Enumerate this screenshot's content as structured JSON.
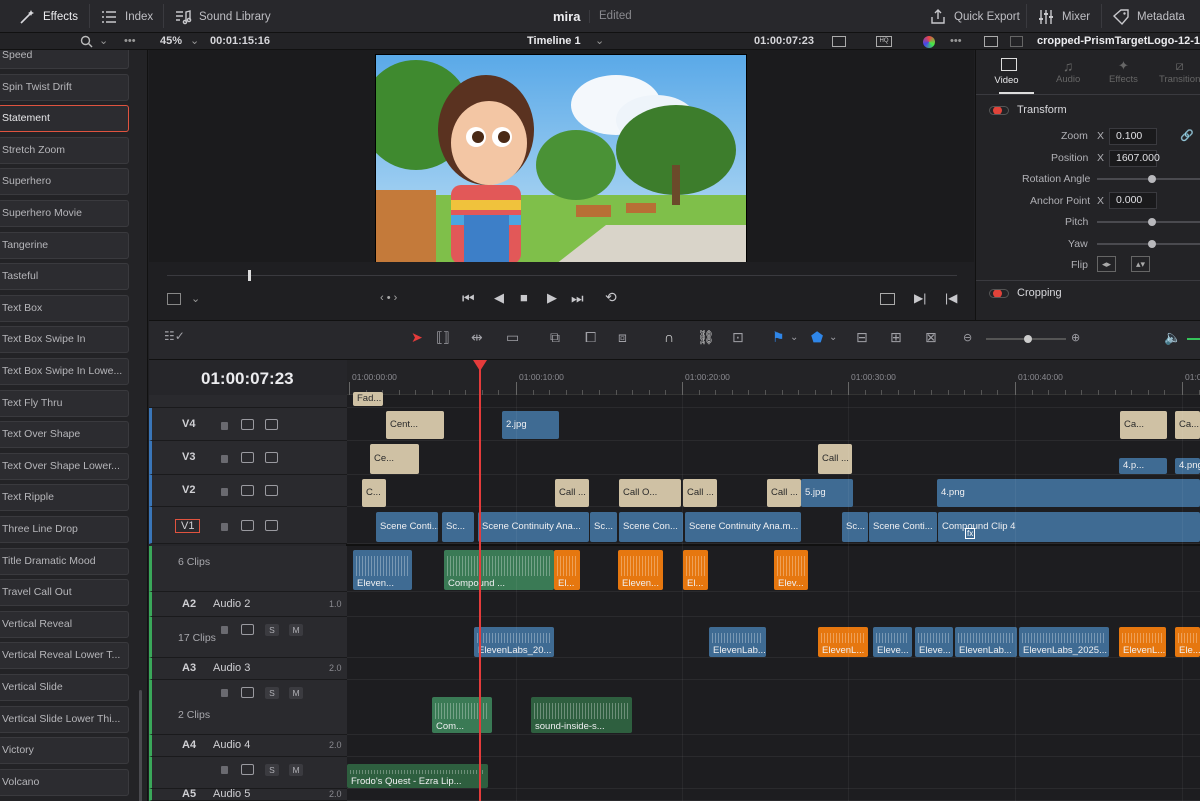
{
  "topbar": {
    "effects": "Effects",
    "index": "Index",
    "sound_library": "Sound Library",
    "project_title": "mira",
    "project_status": "Edited",
    "quick_export": "Quick Export",
    "mixer": "Mixer",
    "metadata": "Metadata"
  },
  "subbar": {
    "zoom": "45%",
    "source_tc": "00:01:15:16",
    "timeline_name": "Timeline 1",
    "record_tc": "01:00:07:23",
    "inspector_clip": "cropped-PrismTargetLogo-12-1"
  },
  "effects_list": [
    "Speed",
    "Spin Twist Drift",
    "Statement",
    "Stretch Zoom",
    "Superhero",
    "Superhero Movie",
    "Tangerine",
    "Tasteful",
    "Text Box",
    "Text Box Swipe In",
    "Text Box Swipe In Lowe...",
    "Text Fly Thru",
    "Text Over Shape",
    "Text Over Shape Lower...",
    "Text Ripple",
    "Three Line Drop",
    "Title Dramatic Mood",
    "Travel Call Out",
    "Vertical Reveal",
    "Vertical Reveal Lower T...",
    "Vertical Slide",
    "Vertical Slide Lower Thi...",
    "Victory",
    "Volcano"
  ],
  "inspector": {
    "tabs": [
      "Video",
      "Audio",
      "Effects",
      "Transition"
    ],
    "transform_label": "Transform",
    "zoom_label": "Zoom",
    "zoom_axis": "X",
    "zoom_value": "0.100",
    "position_label": "Position",
    "position_axis": "X",
    "position_value": "1607.000",
    "rotation_label": "Rotation Angle",
    "anchor_label": "Anchor Point",
    "anchor_axis": "X",
    "anchor_value": "0.000",
    "pitch_label": "Pitch",
    "yaw_label": "Yaw",
    "flip_label": "Flip",
    "cropping_label": "Cropping"
  },
  "timeline": {
    "timecode": "01:00:07:23",
    "ruler": [
      "01:00:00:00",
      "01:00:10:00",
      "01:00:20:00",
      "01:00:30:00",
      "01:00:40:00",
      "01:0"
    ],
    "tracks": {
      "v4": "V4",
      "v3": "V3",
      "v2": "V2",
      "v1": "V1",
      "a1_clips": "6 Clips",
      "a2": "A2",
      "a2_name": "Audio 2",
      "a2_vol": "1.0",
      "a2_clips": "17 Clips",
      "a3": "A3",
      "a3_name": "Audio 3",
      "a3_vol": "2.0",
      "a3_clips": "2 Clips",
      "a4": "A4",
      "a4_name": "Audio 4",
      "a4_vol": "2.0",
      "a5": "A5",
      "a5_name": "Audio 5",
      "a5_vol": "2.0"
    },
    "clips": {
      "fad": "Fad...",
      "cent": "Cent...",
      "jpg2": "2.jpg",
      "ca1": "Ca...",
      "ca2": "Ca...",
      "ce": "Ce...",
      "call1": "Call ...",
      "p4": "4.p...",
      "png4a": "4.png",
      "c": "C...",
      "call2": "Call ...",
      "callo": "Call O...",
      "call3": "Call ...",
      "call4": "Call ...",
      "jpg5": "5.jpg",
      "png4": "4.png",
      "scene1": "Scene Conti...",
      "sc1": "Sc...",
      "scene2": "Scene Continuity Ana...",
      "sc2": "Sc...",
      "scene3": "Scene Con...",
      "scene4": "Scene Continuity Ana.m...",
      "sc3": "Sc...",
      "scene5": "Scene Conti...",
      "compound": "Compound Clip 4",
      "a1_1": "Eleven...",
      "a1_2": "Compound ...",
      "a1_3": "El...",
      "a1_4": "Eleven...",
      "a1_5": "El...",
      "a1_6": "Elev...",
      "a2_1": "ElevenLabs_20...",
      "a2_2": "ElevenLab...",
      "a2_3": "ElevenL...",
      "a2_4": "Eleve...",
      "a2_5": "Eleve...",
      "a2_6": "ElevenLab...",
      "a2_7": "ElevenLabs_2025...",
      "a2_8": "ElevenL...",
      "a2_9": "Ele...",
      "a3_1": "Com...",
      "a3_2": "sound-inside-s...",
      "a4_1": "Frodo's Quest - Ezra Lip..."
    },
    "audio_buttons": {
      "s": "S",
      "m": "M"
    }
  }
}
